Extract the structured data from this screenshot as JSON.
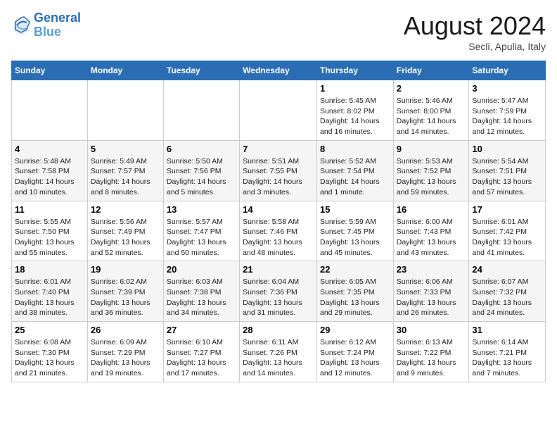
{
  "header": {
    "logo_line1": "General",
    "logo_line2": "Blue",
    "month_year": "August 2024",
    "location": "Secli, Apulia, Italy"
  },
  "days_of_week": [
    "Sunday",
    "Monday",
    "Tuesday",
    "Wednesday",
    "Thursday",
    "Friday",
    "Saturday"
  ],
  "weeks": [
    [
      {
        "day": "",
        "info": ""
      },
      {
        "day": "",
        "info": ""
      },
      {
        "day": "",
        "info": ""
      },
      {
        "day": "",
        "info": ""
      },
      {
        "day": "1",
        "info": "Sunrise: 5:45 AM\nSunset: 8:02 PM\nDaylight: 14 hours\nand 16 minutes."
      },
      {
        "day": "2",
        "info": "Sunrise: 5:46 AM\nSunset: 8:00 PM\nDaylight: 14 hours\nand 14 minutes."
      },
      {
        "day": "3",
        "info": "Sunrise: 5:47 AM\nSunset: 7:59 PM\nDaylight: 14 hours\nand 12 minutes."
      }
    ],
    [
      {
        "day": "4",
        "info": "Sunrise: 5:48 AM\nSunset: 7:58 PM\nDaylight: 14 hours\nand 10 minutes."
      },
      {
        "day": "5",
        "info": "Sunrise: 5:49 AM\nSunset: 7:57 PM\nDaylight: 14 hours\nand 8 minutes."
      },
      {
        "day": "6",
        "info": "Sunrise: 5:50 AM\nSunset: 7:56 PM\nDaylight: 14 hours\nand 5 minutes."
      },
      {
        "day": "7",
        "info": "Sunrise: 5:51 AM\nSunset: 7:55 PM\nDaylight: 14 hours\nand 3 minutes."
      },
      {
        "day": "8",
        "info": "Sunrise: 5:52 AM\nSunset: 7:54 PM\nDaylight: 14 hours\nand 1 minute."
      },
      {
        "day": "9",
        "info": "Sunrise: 5:53 AM\nSunset: 7:52 PM\nDaylight: 13 hours\nand 59 minutes."
      },
      {
        "day": "10",
        "info": "Sunrise: 5:54 AM\nSunset: 7:51 PM\nDaylight: 13 hours\nand 57 minutes."
      }
    ],
    [
      {
        "day": "11",
        "info": "Sunrise: 5:55 AM\nSunset: 7:50 PM\nDaylight: 13 hours\nand 55 minutes."
      },
      {
        "day": "12",
        "info": "Sunrise: 5:56 AM\nSunset: 7:49 PM\nDaylight: 13 hours\nand 52 minutes."
      },
      {
        "day": "13",
        "info": "Sunrise: 5:57 AM\nSunset: 7:47 PM\nDaylight: 13 hours\nand 50 minutes."
      },
      {
        "day": "14",
        "info": "Sunrise: 5:58 AM\nSunset: 7:46 PM\nDaylight: 13 hours\nand 48 minutes."
      },
      {
        "day": "15",
        "info": "Sunrise: 5:59 AM\nSunset: 7:45 PM\nDaylight: 13 hours\nand 45 minutes."
      },
      {
        "day": "16",
        "info": "Sunrise: 6:00 AM\nSunset: 7:43 PM\nDaylight: 13 hours\nand 43 minutes."
      },
      {
        "day": "17",
        "info": "Sunrise: 6:01 AM\nSunset: 7:42 PM\nDaylight: 13 hours\nand 41 minutes."
      }
    ],
    [
      {
        "day": "18",
        "info": "Sunrise: 6:01 AM\nSunset: 7:40 PM\nDaylight: 13 hours\nand 38 minutes."
      },
      {
        "day": "19",
        "info": "Sunrise: 6:02 AM\nSunset: 7:39 PM\nDaylight: 13 hours\nand 36 minutes."
      },
      {
        "day": "20",
        "info": "Sunrise: 6:03 AM\nSunset: 7:38 PM\nDaylight: 13 hours\nand 34 minutes."
      },
      {
        "day": "21",
        "info": "Sunrise: 6:04 AM\nSunset: 7:36 PM\nDaylight: 13 hours\nand 31 minutes."
      },
      {
        "day": "22",
        "info": "Sunrise: 6:05 AM\nSunset: 7:35 PM\nDaylight: 13 hours\nand 29 minutes."
      },
      {
        "day": "23",
        "info": "Sunrise: 6:06 AM\nSunset: 7:33 PM\nDaylight: 13 hours\nand 26 minutes."
      },
      {
        "day": "24",
        "info": "Sunrise: 6:07 AM\nSunset: 7:32 PM\nDaylight: 13 hours\nand 24 minutes."
      }
    ],
    [
      {
        "day": "25",
        "info": "Sunrise: 6:08 AM\nSunset: 7:30 PM\nDaylight: 13 hours\nand 21 minutes."
      },
      {
        "day": "26",
        "info": "Sunrise: 6:09 AM\nSunset: 7:29 PM\nDaylight: 13 hours\nand 19 minutes."
      },
      {
        "day": "27",
        "info": "Sunrise: 6:10 AM\nSunset: 7:27 PM\nDaylight: 13 hours\nand 17 minutes."
      },
      {
        "day": "28",
        "info": "Sunrise: 6:11 AM\nSunset: 7:26 PM\nDaylight: 13 hours\nand 14 minutes."
      },
      {
        "day": "29",
        "info": "Sunrise: 6:12 AM\nSunset: 7:24 PM\nDaylight: 13 hours\nand 12 minutes."
      },
      {
        "day": "30",
        "info": "Sunrise: 6:13 AM\nSunset: 7:22 PM\nDaylight: 13 hours\nand 9 minutes."
      },
      {
        "day": "31",
        "info": "Sunrise: 6:14 AM\nSunset: 7:21 PM\nDaylight: 13 hours\nand 7 minutes."
      }
    ]
  ]
}
